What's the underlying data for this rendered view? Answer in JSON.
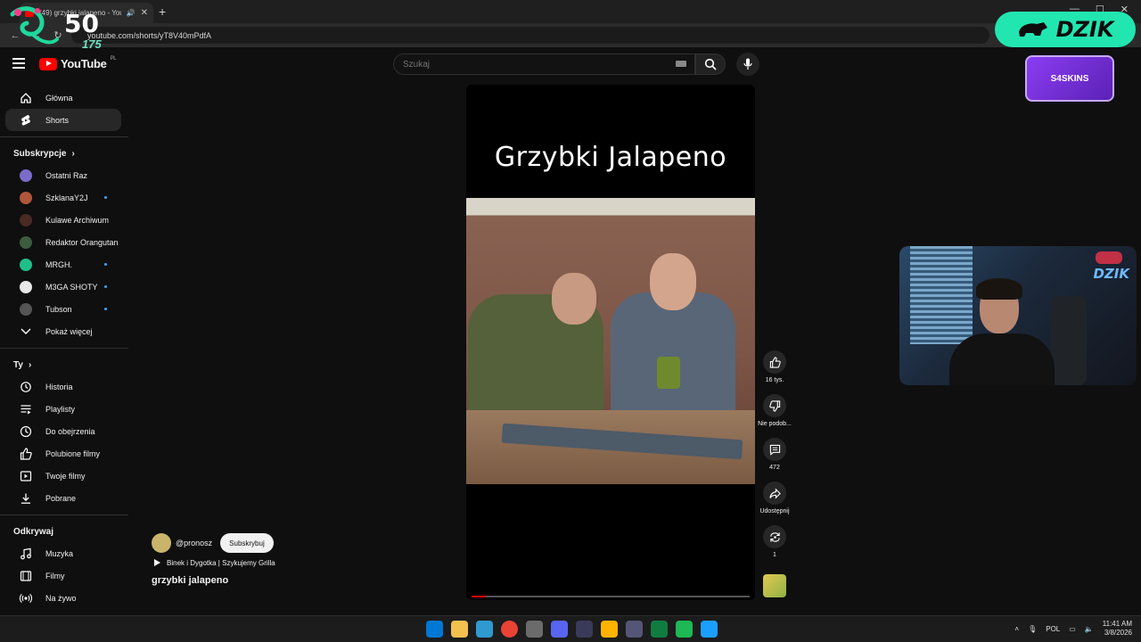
{
  "browser": {
    "tab_title": "(49) grzybki jalapeno - YouTube",
    "url": "youtube.com/shorts/yT8V40mPdfA"
  },
  "overlay": {
    "counter_value": "50",
    "counter_sub": "175",
    "sponsor_label": "DZIK",
    "partner_label": "S4SKINS"
  },
  "header": {
    "logo_text": "YouTube",
    "logo_region": "PL",
    "search_placeholder": "Szukaj"
  },
  "sidebar": {
    "primary": [
      {
        "label": "Główna",
        "icon": "home-icon"
      },
      {
        "label": "Shorts",
        "icon": "shorts-icon",
        "active": true
      }
    ],
    "subscriptions_title": "Subskrypcje",
    "subscriptions": [
      {
        "label": "Ostatni Raz",
        "color": "#7b6cc9",
        "live": false
      },
      {
        "label": "SzklanaY2J",
        "color": "#b0563a",
        "live": true
      },
      {
        "label": "Kulawe Archiwum",
        "color": "#4a2a22",
        "live": false
      },
      {
        "label": "Redaktor Orangutan",
        "color": "#3d5c3f",
        "live": false
      },
      {
        "label": "MRGH.",
        "color": "#1fbf8a",
        "live": true
      },
      {
        "label": "M3GA SHOTY",
        "color": "#e8e8e8",
        "live": true
      },
      {
        "label": "Tubson",
        "color": "#555555",
        "live": true
      }
    ],
    "show_more": "Pokaż więcej",
    "you_title": "Ty",
    "you_items": [
      {
        "label": "Historia",
        "icon": "history-icon"
      },
      {
        "label": "Playlisty",
        "icon": "playlist-icon"
      },
      {
        "label": "Do obejrzenia",
        "icon": "clock-icon"
      },
      {
        "label": "Polubione filmy",
        "icon": "like-icon"
      },
      {
        "label": "Twoje filmy",
        "icon": "video-icon"
      },
      {
        "label": "Pobrane",
        "icon": "download-icon"
      }
    ],
    "explore_title": "Odkrywaj",
    "explore_items": [
      {
        "label": "Muzyka",
        "icon": "music-icon"
      },
      {
        "label": "Filmy",
        "icon": "film-icon"
      },
      {
        "label": "Na żywo",
        "icon": "live-icon"
      }
    ]
  },
  "video": {
    "overlay_title": "Grzybki Jalapeno",
    "progress": 0.05
  },
  "actions": {
    "like_count": "16 tys.",
    "dislike_label": "Nie podob...",
    "comments_count": "472",
    "share_label": "Udostępnij",
    "remix_count": "1"
  },
  "channel": {
    "handle": "@pronosz",
    "subscribe_label": "Subskrybuj",
    "playlist_label": "Binek i Dygotka | Szykujemy Grilla",
    "short_title": "grzybki jalapeno"
  },
  "webcam": {
    "logo_text": "DZIK"
  },
  "taskbar": {
    "language": "POL",
    "time": "11:41 AM",
    "date": "3/8/2026",
    "app_colors": [
      "#0078d4",
      "#f2c14e",
      "#2e9ad0",
      "#ea4335",
      "#6b6b6b",
      "#5865f2",
      "#3a3a5a",
      "#ffb300",
      "#555577",
      "#107c41",
      "#1db954",
      "#1a9fff"
    ]
  }
}
